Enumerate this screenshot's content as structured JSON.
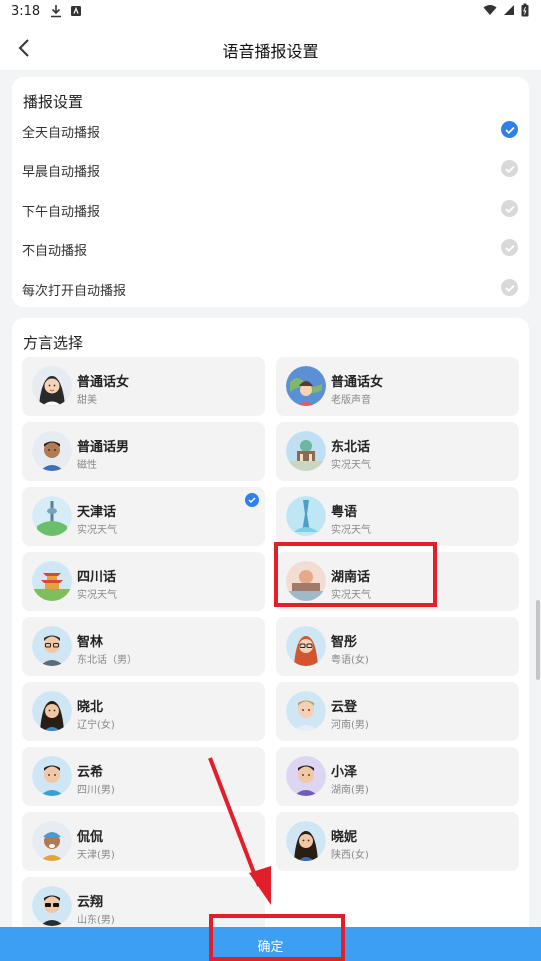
{
  "status_bar": {
    "time": "3:18"
  },
  "nav": {
    "title": "语音播报设置"
  },
  "broadcast": {
    "title": "播报设置",
    "options": [
      {
        "label": "全天自动播报",
        "checked": true
      },
      {
        "label": "早晨自动播报",
        "checked": false
      },
      {
        "label": "下午自动播报",
        "checked": false
      },
      {
        "label": "不自动播报",
        "checked": false
      },
      {
        "label": "每次打开自动播报",
        "checked": false
      }
    ]
  },
  "dialects": {
    "title": "方言选择",
    "items": [
      {
        "name": "普通话女",
        "desc": "甜美",
        "avatar": "woman-avatar-icon",
        "selected": false
      },
      {
        "name": "普通话女",
        "desc": "老版声音",
        "avatar": "globe-avatar-icon",
        "selected": false
      },
      {
        "name": "普通话男",
        "desc": "磁性",
        "avatar": "man-avatar-icon",
        "selected": false
      },
      {
        "name": "东北话",
        "desc": "实况天气",
        "avatar": "northeast-landmark-icon",
        "selected": false
      },
      {
        "name": "天津话",
        "desc": "实况天气",
        "avatar": "tianjin-tower-icon",
        "selected": true
      },
      {
        "name": "粤语",
        "desc": "实况天气",
        "avatar": "canton-tower-icon",
        "selected": false
      },
      {
        "name": "四川话",
        "desc": "实况天气",
        "avatar": "sichuan-pagoda-icon",
        "selected": false
      },
      {
        "name": "湖南话",
        "desc": "实况天气",
        "avatar": "hunan-landmark-icon",
        "selected": false
      },
      {
        "name": "智林",
        "desc": "东北话（男）",
        "avatar": "man-glasses-avatar-icon",
        "selected": false
      },
      {
        "name": "智彤",
        "desc": "粤语(女)",
        "avatar": "woman-redhair-avatar-icon",
        "selected": false
      },
      {
        "name": "晓北",
        "desc": "辽宁(女)",
        "avatar": "woman-avatar-icon",
        "selected": false
      },
      {
        "name": "云登",
        "desc": "河南(男)",
        "avatar": "man-avatar-icon",
        "selected": false
      },
      {
        "name": "云希",
        "desc": "四川(男)",
        "avatar": "man-avatar-icon",
        "selected": false
      },
      {
        "name": "小泽",
        "desc": "湖南(男)",
        "avatar": "man-avatar-icon",
        "selected": false
      },
      {
        "name": "侃侃",
        "desc": "天津(男)",
        "avatar": "man-cap-avatar-icon",
        "selected": false
      },
      {
        "name": "晓妮",
        "desc": "陕西(女)",
        "avatar": "woman-avatar-icon",
        "selected": false
      },
      {
        "name": "云翔",
        "desc": "山东(男)",
        "avatar": "man-sunglasses-avatar-icon",
        "selected": false
      }
    ]
  },
  "confirm": {
    "label": "确定"
  },
  "colors": {
    "accent": "#2f80ed",
    "confirm_bar": "#3c9ff1",
    "annotation": "#e21e2a"
  }
}
